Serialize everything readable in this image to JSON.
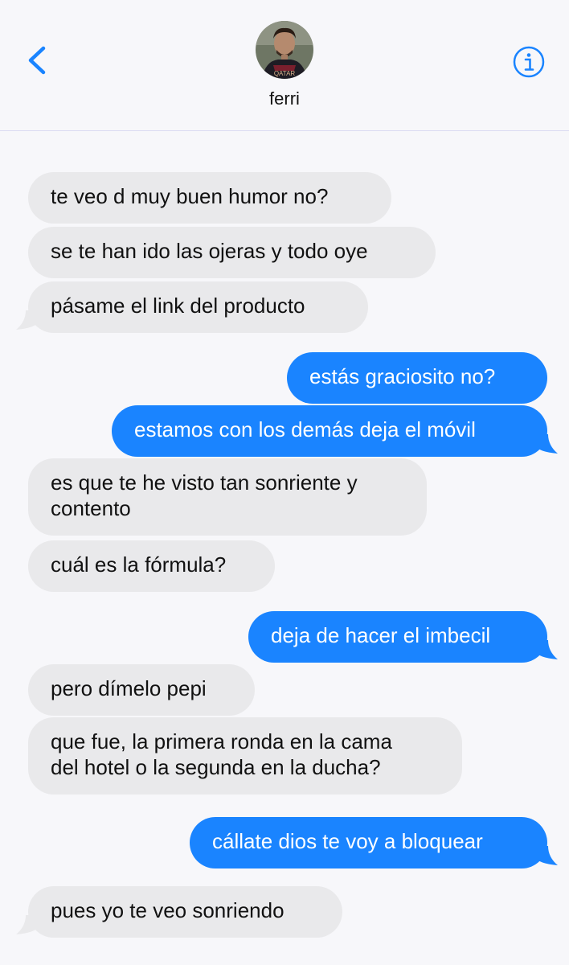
{
  "contact": {
    "name": "ferri",
    "avatar_jersey_text": "QATAR"
  },
  "icons": {
    "back": "chevron-left-icon",
    "info": "info-circle-icon"
  },
  "colors": {
    "accent": "#1a84ff",
    "incoming": "#e9e9eb",
    "background": "#f7f7fa"
  },
  "messages": [
    {
      "dir": "in",
      "text": "te veo d muy buen humor no?"
    },
    {
      "dir": "in",
      "text": "se te han ido las ojeras y todo oye"
    },
    {
      "dir": "in",
      "text": "pásame el link del producto"
    },
    {
      "dir": "out",
      "text": "estás graciosito no?"
    },
    {
      "dir": "out",
      "text": "estamos con los demás deja el móvil"
    },
    {
      "dir": "in",
      "lines": [
        "es que te he visto tan sonriente y",
        "contento"
      ]
    },
    {
      "dir": "in",
      "text": "cuál es la fórmula?"
    },
    {
      "dir": "out",
      "text": "deja de hacer el imbecil"
    },
    {
      "dir": "in",
      "text": "pero dímelo pepi"
    },
    {
      "dir": "in",
      "lines": [
        "que fue, la primera ronda en la cama",
        "del hotel o la segunda en la ducha?"
      ]
    },
    {
      "dir": "out",
      "text": "cállate dios te voy a bloquear"
    },
    {
      "dir": "in",
      "text": "pues yo te veo sonriendo"
    }
  ]
}
